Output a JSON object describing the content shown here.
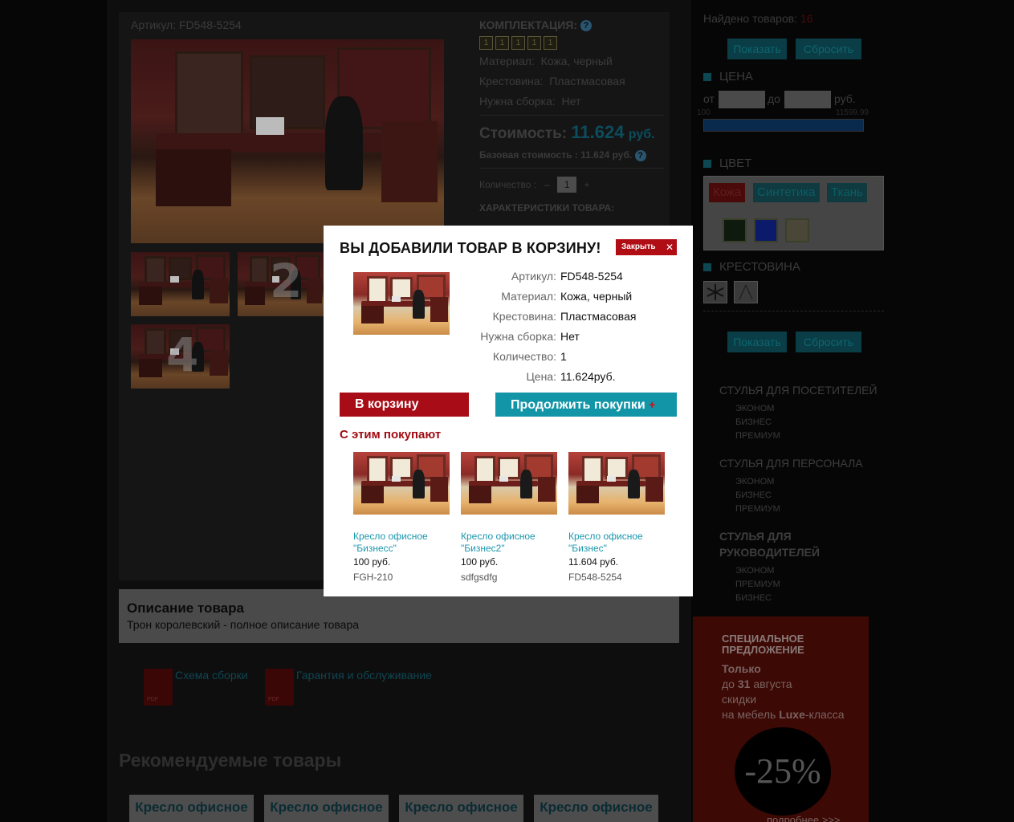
{
  "product": {
    "article_top": "Артикул: FD548-5254",
    "komplektaciya_title": "КОМПЛЕКТАЦИЯ:",
    "komplektaciya_boxes": [
      "1",
      "1",
      "1",
      "1",
      "1"
    ],
    "specs": [
      {
        "label": "Материал:",
        "value": "Кожа, черный"
      },
      {
        "label": "Крестовина:",
        "value": "Пластмасовая"
      },
      {
        "label": "Нужна сборка:",
        "value": "Нет"
      }
    ],
    "cost_label": "Стоимость:",
    "cost_value": "11.624",
    "cost_currency": "руб.",
    "base_cost": "Базовая стоимость : 11.624 руб.",
    "qty_label": "Количество :",
    "qty_minus": "–",
    "qty_value": "1",
    "qty_plus": "+",
    "characteristics": "ХАРАКТЕРИСТИКИ ТОВАРА:",
    "thumb_numbers": [
      "2",
      "4"
    ]
  },
  "description": {
    "title": "Описание товара",
    "text": "Трон королевский - полное описание товара"
  },
  "documents": [
    {
      "label": "Схема сборки",
      "icon": "pdf-icon",
      "badge": "PDF"
    },
    {
      "label": "Гарантия и обслуживание",
      "icon": "pdf-icon",
      "badge": "PDF"
    }
  ],
  "recommended": {
    "title": "Рекомендуемые товары",
    "tabs": [
      "Кресло офисное",
      "Кресло офисное",
      "Кресло офисное",
      "Кресло офисное"
    ]
  },
  "sidebar": {
    "found_label": "Найдено товаров:",
    "found_count": "16",
    "show_label": "Показать",
    "reset_label": "Сбросить",
    "price_head": "ЦЕНА",
    "price_from": "от",
    "price_to": "до",
    "price_currency": "руб.",
    "price_min": "100",
    "price_max": "11599.99",
    "color_head": "ЦВЕТ",
    "color_tabs": [
      "Кожа",
      "Синтетика",
      "Ткань"
    ],
    "swatches": [
      "#0e1a0e",
      "#0b1a6a",
      "#4a4638"
    ],
    "cross_head": "КРЕСТОВИНА",
    "categories": [
      {
        "title": "СТУЛЬЯ ДЛЯ ПОСЕТИТЕЛЕЙ",
        "items": [
          "ЭКОНОМ",
          "БИЗНЕС",
          "ПРЕМИУМ"
        ]
      },
      {
        "title": "СТУЛЬЯ ДЛЯ ПЕРСОНАЛА",
        "items": [
          "ЭКОНОМ",
          "БИЗНЕС",
          "ПРЕМИУМ"
        ]
      },
      {
        "title_line1": "СТУЛЬЯ ДЛЯ",
        "title_line2": "РУКОВОДИТЕЛЕЙ",
        "items": [
          "ЭКОНОМ",
          "ПРЕМИУМ",
          "БИЗНЕС"
        ]
      }
    ]
  },
  "promo": {
    "line1": "СПЕЦИАЛЬНОЕ",
    "line2": "ПРЕДЛОЖЕНИЕ",
    "line3": "Только",
    "line4_pre": "до ",
    "line4_bold": "31",
    "line4_post": " августа",
    "line5": "скидки",
    "line6_pre": "на мебель ",
    "line6_bold": "Luxe",
    "line6_post": "-класса",
    "discount": "-25%",
    "more": "подробнее >>>"
  },
  "modal": {
    "title": "ВЫ ДОБАВИЛИ ТОВАР В КОРЗИНУ!",
    "close_label": "Закрыть",
    "close_icon": "close-icon",
    "fields": [
      {
        "label": "Артикул:",
        "value": "FD548-5254"
      },
      {
        "label": "Материал:",
        "value": "Кожа, черный"
      },
      {
        "label": "Крестовина:",
        "value": "Пластмасовая"
      },
      {
        "label": "Нужна сборка:",
        "value": "Нет"
      },
      {
        "label": "Количество:",
        "value": "1"
      },
      {
        "label": "Цена:",
        "value": "11.624руб."
      }
    ],
    "to_cart": "В корзину",
    "continue": "Продолжить покупки",
    "continue_plus": "+",
    "also_title": "С этим покупают",
    "also": [
      {
        "name1": "Кресло офисное",
        "name2": "\"Бизнесс\"",
        "price": "100 руб.",
        "sku": "FGH-210"
      },
      {
        "name1": "Кресло офисное",
        "name2": "\"Бизнес2\"",
        "price": "100 руб.",
        "sku": "sdfgsdfg"
      },
      {
        "name1": "Кресло офисное",
        "name2": "\"Бизнес\"",
        "price": "11.604 руб.",
        "sku": "FD548-5254"
      }
    ]
  },
  "colors": {
    "modal_red": "#a80c17",
    "modal_teal": "#1395a8",
    "link_teal": "#1a96ad",
    "overlay": "#060606"
  }
}
